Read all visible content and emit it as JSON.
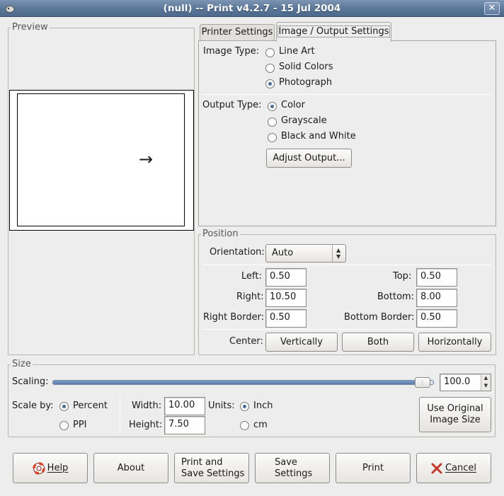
{
  "window": {
    "title": "(null) -- Print v4.2.7 - 15 Jul 2004",
    "close_glyph": "✕"
  },
  "preview": {
    "label": "Preview",
    "arrow": "→"
  },
  "tabs": [
    {
      "label": "Printer Settings",
      "active": false
    },
    {
      "label": "Image / Output Settings",
      "active": true
    }
  ],
  "image_type": {
    "label": "Image Type:",
    "options": [
      {
        "label": "Line Art",
        "selected": false
      },
      {
        "label": "Solid Colors",
        "selected": false
      },
      {
        "label": "Photograph",
        "selected": true
      }
    ]
  },
  "output_type": {
    "label": "Output Type:",
    "options": [
      {
        "label": "Color",
        "selected": true
      },
      {
        "label": "Grayscale",
        "selected": false
      },
      {
        "label": "Black and White",
        "selected": false
      }
    ],
    "adjust_button": "Adjust Output..."
  },
  "position": {
    "label": "Position",
    "orientation_label": "Orientation:",
    "orientation_value": "Auto",
    "left_label": "Left:",
    "left_value": "0.50",
    "top_label": "Top:",
    "top_value": "0.50",
    "right_label": "Right:",
    "right_value": "10.50",
    "bottom_label": "Bottom:",
    "bottom_value": "8.00",
    "right_border_label": "Right Border:",
    "right_border_value": "0.50",
    "bottom_border_label": "Bottom Border:",
    "bottom_border_value": "0.50",
    "center_label": "Center:",
    "center_buttons": [
      "Vertically",
      "Both",
      "Horizontally"
    ]
  },
  "size": {
    "label": "Size",
    "scaling_label": "Scaling:",
    "scaling_value": "100.0",
    "scaling_fraction": 0.99,
    "scale_by_label": "Scale by:",
    "scale_by_options": [
      {
        "label": "Percent",
        "selected": true
      },
      {
        "label": "PPI",
        "selected": false
      }
    ],
    "width_label": "Width:",
    "width_value": "10.00",
    "height_label": "Height:",
    "height_value": "7.50",
    "units_label": "Units:",
    "units_options": [
      {
        "label": "Inch",
        "selected": true
      },
      {
        "label": "cm",
        "selected": false
      }
    ],
    "original_size_button_line1": "Use Original",
    "original_size_button_line2": "Image Size"
  },
  "footer": {
    "help": "Help",
    "about": "About",
    "print_save_line1": "Print and",
    "print_save_line2": "Save Settings",
    "save_line1": "Save",
    "save_line2": "Settings",
    "print": "Print",
    "cancel": "Cancel"
  },
  "colors": {
    "titlebar": "#5a7598",
    "accent": "#4a6a96",
    "cancel_icon": "#c0392b",
    "help_icon": "#d9452b"
  }
}
